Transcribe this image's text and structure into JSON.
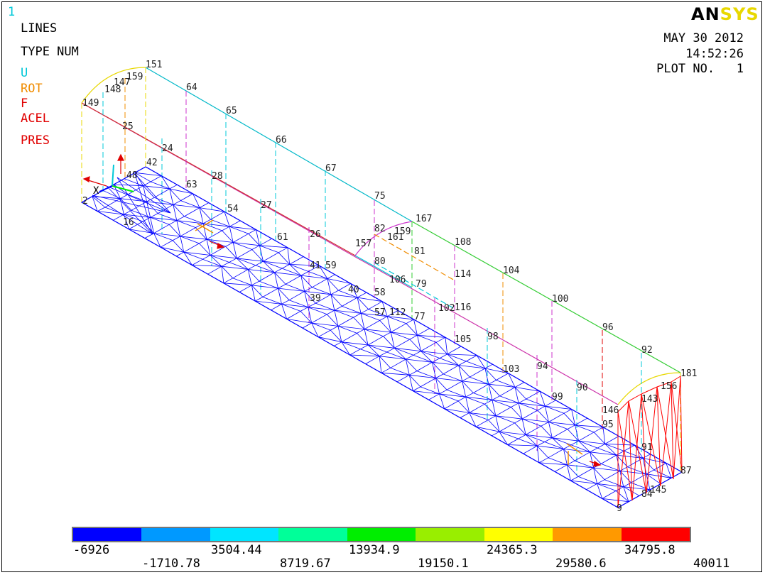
{
  "window_number": "1",
  "legend": {
    "title": "LINES",
    "type": "TYPE NUM",
    "items": [
      {
        "label": "U",
        "color": "#00c8d8"
      },
      {
        "label": "ROT",
        "color": "#f08c00"
      },
      {
        "label": "F",
        "color": "#e00000"
      },
      {
        "label": "ACEL",
        "color": "#e00000"
      },
      {
        "label": "PRES",
        "color": "#e00000"
      }
    ]
  },
  "logo": {
    "an": "AN",
    "sys": "SYS"
  },
  "header": {
    "date": "MAY 30 2012",
    "time": "14:52:26",
    "plot_no": "PLOT NO.   1"
  },
  "triad": {
    "x_label": "X"
  },
  "line_numbers": {
    "top_edge": [
      "64",
      "65",
      "66",
      "67",
      "75",
      "167",
      "108",
      "104",
      "100",
      "96",
      "92",
      "181"
    ],
    "left_end": [
      "151",
      "159",
      "147",
      "148",
      "149",
      "25",
      "24",
      "42",
      "48",
      "2",
      "16"
    ],
    "mid_lower": [
      "63",
      "28",
      "54",
      "27",
      "61",
      "26",
      "59",
      "41",
      "40",
      "39",
      "58",
      "57"
    ],
    "mid_step": [
      "82",
      "159",
      "161",
      "157",
      "81",
      "80",
      "79",
      "114",
      "116",
      "106",
      "112",
      "102",
      "77",
      "105",
      "98"
    ],
    "right_lower": [
      "103",
      "94",
      "90",
      "99",
      "95",
      "87",
      "91",
      "84",
      "145",
      "9",
      "146",
      "143",
      "156"
    ]
  },
  "colorbar": {
    "colors": [
      "#0000ff",
      "#0099ff",
      "#00e5ff",
      "#00ff99",
      "#00ee00",
      "#99ee00",
      "#ffff00",
      "#ff9900",
      "#ff0000"
    ],
    "labels_top": [
      "-6926",
      "3504.44",
      "13934.9",
      "24365.3",
      "34795.8"
    ],
    "labels_bottom": [
      "-1710.78",
      "8719.67",
      "19150.1",
      "29580.6",
      "40011"
    ]
  }
}
